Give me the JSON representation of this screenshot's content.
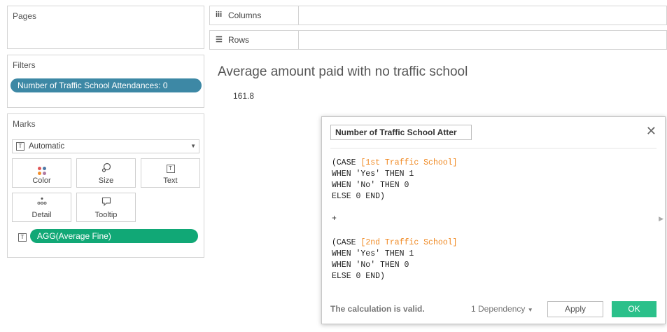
{
  "pages": {
    "title": "Pages"
  },
  "filters": {
    "title": "Filters",
    "pill": "Number of Traffic School Attendances: 0"
  },
  "marks": {
    "title": "Marks",
    "type_select": "Automatic",
    "buttons": [
      {
        "label": "Color",
        "icon": "color-icon"
      },
      {
        "label": "Size",
        "icon": "size-icon"
      },
      {
        "label": "Text",
        "icon": "text-icon"
      },
      {
        "label": "Detail",
        "icon": "detail-icon"
      },
      {
        "label": "Tooltip",
        "icon": "tooltip-icon"
      }
    ],
    "pill": "AGG(Average Fine)"
  },
  "shelves": {
    "columns": "Columns",
    "rows": "Rows"
  },
  "view": {
    "title": "Average amount paid with no traffic school",
    "value": "161.8"
  },
  "calc": {
    "name": "Number of Traffic School Atter",
    "block1": {
      "l1_prefix": "(CASE ",
      "l1_ref": "[1st Traffic School]",
      "l2": "WHEN 'Yes' THEN 1",
      "l3": "WHEN 'No' THEN 0",
      "l4": "ELSE 0 END)"
    },
    "plus": "+",
    "block2": {
      "l1_prefix": "(CASE ",
      "l1_ref": "[2nd Traffic School]",
      "l2": "WHEN 'Yes' THEN 1",
      "l3": "WHEN 'No' THEN 0",
      "l4": "ELSE 0 END)"
    },
    "status": "The calculation is valid.",
    "dependency": "1 Dependency",
    "apply": "Apply",
    "ok": "OK"
  },
  "colors": {
    "filter_pill": "#3d88a5",
    "measure_pill": "#11a876",
    "ok_button": "#2bc08a",
    "field_ref": "#f08a24"
  }
}
